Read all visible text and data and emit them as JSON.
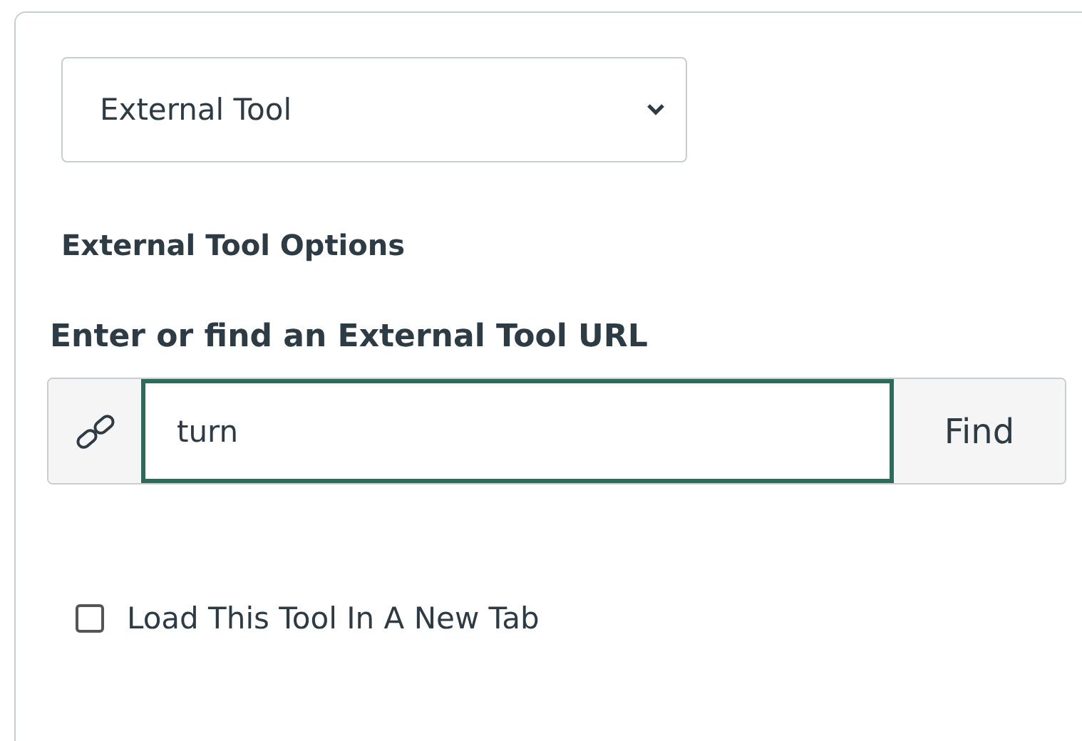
{
  "tool_type_select": {
    "value": "External Tool"
  },
  "options_heading": "External Tool Options",
  "url_label": "Enter or find an External Tool URL",
  "url_field": {
    "value": "turn",
    "button": "Find"
  },
  "new_tab_checkbox": {
    "label": "Load This Tool In A New Tab",
    "checked": false
  }
}
